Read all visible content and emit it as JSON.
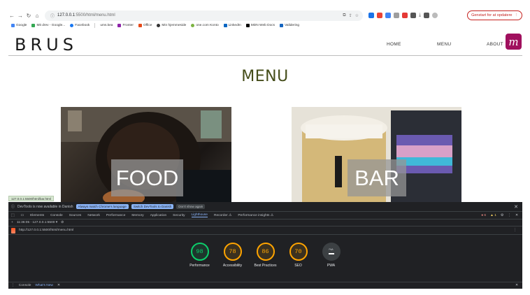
{
  "browser": {
    "url_host": "127.0.0.1",
    "url_path": ":5500/html/menu.html",
    "update_label": "Genstart for at opdatere",
    "bookmarks": [
      "Google",
      "Mit drev - Google...",
      "Facebook",
      "ums.kea",
      "Fronter",
      "Office",
      "Min hjemmeside",
      "one.com Konto",
      "LinkedIn",
      "MDN Web Docs",
      "Validering"
    ]
  },
  "site": {
    "logo": "BRUS",
    "nav": {
      "home": "HOME",
      "menu": "MENU",
      "about": "ABOUT"
    },
    "badge": "m",
    "title": "MENU",
    "cards": {
      "food": "FOOD",
      "bar": "BAR"
    },
    "status_url": "127.0.0.1:5500/html/bar.html"
  },
  "devtools": {
    "notice": "DevTools is now available in Danish",
    "btn_match": "Always match Chrome's language",
    "btn_switch": "Switch DevTools to Danish",
    "btn_dont": "Don't show again",
    "tabs": [
      "Elements",
      "Console",
      "Sources",
      "Network",
      "Performance",
      "Memory",
      "Application",
      "Security",
      "Lighthouse",
      "Recorder ⚠",
      "Performance insights ⚠"
    ],
    "active_tab": "Lighthouse",
    "errors": "6",
    "warnings": "1",
    "sub_label": "11:36:05 - 127.0.0.1:5500 ▾",
    "report_url": "http://127.0.0.1:5500/html/menu.html",
    "scores": [
      {
        "value": "98",
        "label": "Performance",
        "status": "green"
      },
      {
        "value": "78",
        "label": "Accessibility",
        "status": "orange"
      },
      {
        "value": "86",
        "label": "Best Practices",
        "status": "orange"
      },
      {
        "value": "70",
        "label": "SEO",
        "status": "orange"
      }
    ],
    "pwa": {
      "badge": "PWA",
      "label": "PWA"
    },
    "drawer_tabs": [
      "Console",
      "What's New"
    ]
  }
}
